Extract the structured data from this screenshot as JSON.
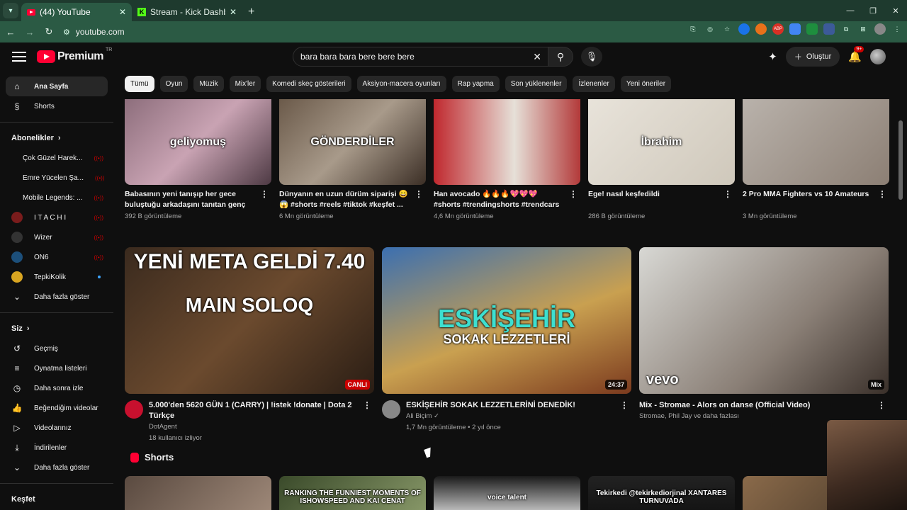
{
  "browser": {
    "tabs": [
      {
        "title": "(44) YouTube",
        "active": true,
        "favicon": "youtube-favicon"
      },
      {
        "title": "Stream - Kick Dashboard",
        "active": false,
        "favicon": "kick-favicon"
      }
    ],
    "new_tab": "+",
    "url": "youtube.com",
    "window_controls": {
      "minimize": "—",
      "maximize": "❐",
      "close": "✕"
    }
  },
  "header": {
    "logo": "Premium",
    "logo_sup": "TR",
    "search_value": "bara bara bara bere bere bere",
    "create_label": "Oluştur",
    "notifications": "9+"
  },
  "sidebar": {
    "main": [
      {
        "label": "Ana Sayfa",
        "icon": "home-icon",
        "glyph": "⌂"
      },
      {
        "label": "Shorts",
        "icon": "shorts-icon",
        "glyph": "§"
      }
    ],
    "subs_heading": "Abonelikler",
    "subscriptions": [
      {
        "label": "Çok Güzel Harek...",
        "status": "live",
        "color": "#b23a48"
      },
      {
        "label": "Emre Yücelen Şa...",
        "status": "live",
        "color": "#6b6b6b"
      },
      {
        "label": "Mobile Legends: ...",
        "status": "live",
        "color": "#4a6fa5"
      },
      {
        "label": "I T A C H I",
        "status": "live",
        "color": "#7a1c1c"
      },
      {
        "label": "Wizer",
        "status": "live",
        "color": "#333333"
      },
      {
        "label": "ON6",
        "status": "live",
        "color": "#1c4f7a"
      },
      {
        "label": "TepkiKolik",
        "status": "new",
        "color": "#d9a521"
      }
    ],
    "show_more": "Daha fazla göster",
    "you_heading": "Siz",
    "you_items": [
      {
        "label": "Geçmiş",
        "glyph": "↺",
        "icon": "history-icon"
      },
      {
        "label": "Oynatma listeleri",
        "glyph": "≡",
        "icon": "playlists-icon"
      },
      {
        "label": "Daha sonra izle",
        "glyph": "◷",
        "icon": "watch-later-icon"
      },
      {
        "label": "Beğendiğim videolar",
        "glyph": "👍",
        "icon": "liked-icon"
      },
      {
        "label": "Videolarınız",
        "glyph": "▷",
        "icon": "your-videos-icon"
      },
      {
        "label": "İndirilenler",
        "glyph": "⤓",
        "icon": "downloads-icon"
      }
    ],
    "show_more_2": "Daha fazla göster",
    "explore_heading": "Keşfet"
  },
  "chips": [
    "Tümü",
    "Oyun",
    "Müzik",
    "Mix'ler",
    "Komedi skeç gösterileri",
    "Aksiyon-macera oyunları",
    "Rap yapma",
    "Son yüklenenler",
    "İzlenenler",
    "Yeni öneriler"
  ],
  "shorts_row": [
    {
      "title": "Babasının yeni tanışıp her gece buluştuğu arkadaşını tanıtan genç kı...",
      "views": "392 B görüntüleme",
      "overlay": "geliyomuş",
      "bg": "linear-gradient(135deg,#8d6e7c,#c9a3b3 50%,#4e3a44)"
    },
    {
      "title": "Dünyanın en uzun dürüm siparişi 😄😱 #shorts #reels #tiktok #keşfet ...",
      "views": "6 Mn görüntüleme",
      "overlay": "GÖNDERDİLER",
      "bg": "linear-gradient(135deg,#6b5a4a,#a89a8a 50%,#3c2f26)"
    },
    {
      "title": "Han avocado 🔥🔥🔥💖💖💖 #shorts #trendingshorts #trendcars ...",
      "views": "4,6 Mn görüntüleme",
      "overlay": "",
      "bg": "linear-gradient(90deg,#c0282e,#e6e0d8 55%,#b33a3a)"
    },
    {
      "title": "Ege! nasıl keşfedildi",
      "views": "286 B görüntüleme",
      "overlay": "İbrahim",
      "bg": "linear-gradient(135deg,#e8e3da,#cfc8bb)"
    },
    {
      "title": "2 Pro MMA Fighters vs 10 Amateurs",
      "views": "3 Mn görüntüleme",
      "overlay": "",
      "bg": "linear-gradient(135deg,#b9b2ab,#8c7f74)"
    }
  ],
  "videos": [
    {
      "title": "5.000'den 5620 GÜN 1 (CARRY) | !istek !donate | Dota 2 Türkçe",
      "channel": "DotAgent",
      "meta": "18 kullanıcı izliyor",
      "badge": "CANLI",
      "badge_type": "live",
      "overlay1": "YENİ META GELDİ 7.40",
      "overlay2": "MAIN SOLOQ",
      "bg": "linear-gradient(135deg,#3a2a1e,#6b4a2e 50%,#2a1d14)",
      "avatar_color": "#c8102e"
    },
    {
      "title": "ESKİŞEHİR SOKAK LEZZETLERİNİ DENEDİK!",
      "channel": "Ali Biçim ✓",
      "meta": "1,7 Mn görüntüleme • 2 yıl önce",
      "badge": "24:37",
      "badge_type": "time",
      "overlay1": "ESKİŞEHİR",
      "overlay2": "SOKAK LEZZETLERİ",
      "bg": "linear-gradient(160deg,#3b6fb0,#c9a050 55%,#7b3a1e)",
      "avatar_color": "#888888"
    },
    {
      "title": "Mix - Stromae - Alors on danse (Official Video)",
      "channel": "Stromae, Phil Jay ve daha fazlası",
      "meta": "",
      "badge": "Mix",
      "badge_type": "mix",
      "overlay1": "vevo",
      "overlay2": "",
      "bg": "linear-gradient(135deg,#d8d8d4,#8a7f76 60%,#3a302a)",
      "avatar_color": ""
    }
  ],
  "shorts_heading": "Shorts",
  "shorts_row2": [
    {
      "overlay": "",
      "bg": "linear-gradient(135deg,#5a4a40,#a08a7a)"
    },
    {
      "overlay": "RANKING THE FUNNIEST MOMENTS OF ISHOWSPEED AND KAI CENAT",
      "bg": "linear-gradient(135deg,#3a4a2a,#8a9a6a)"
    },
    {
      "overlay": "voice talent",
      "bg": "linear-gradient(180deg,#1a1a1a,#e0e0e0)"
    },
    {
      "overlay": "Tekirkedi @tekirkediorjinal XANTARES TURNUVADA",
      "bg": "linear-gradient(180deg,#222,#111)"
    },
    {
      "overlay": "",
      "bg": "linear-gradient(135deg,#8a6a4a,#4a3a2a)"
    }
  ]
}
